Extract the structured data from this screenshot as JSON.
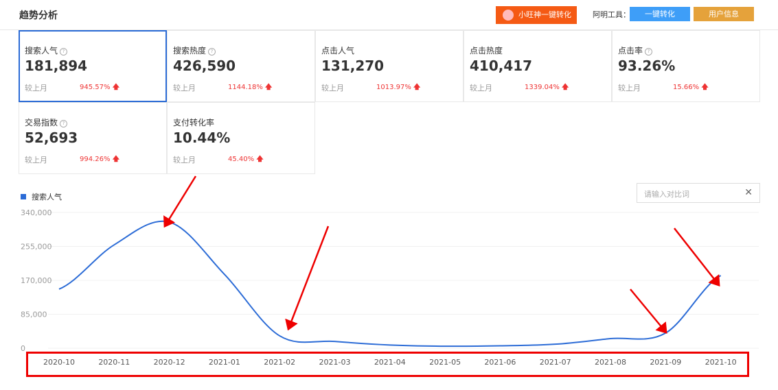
{
  "header": {
    "title": "趋势分析",
    "xiaowang_button": "小旺神一键转化",
    "tools_label": "阿明工具：",
    "convert_button": "一键转化",
    "user_info_button": "用户信息"
  },
  "cards": [
    {
      "label": "搜索人气",
      "value": "181,894",
      "compare": "较上月",
      "change": "945.57%",
      "help": true
    },
    {
      "label": "搜索热度",
      "value": "426,590",
      "compare": "较上月",
      "change": "1144.18%",
      "help": true
    },
    {
      "label": "点击人气",
      "value": "131,270",
      "compare": "较上月",
      "change": "1013.97%",
      "help": false
    },
    {
      "label": "点击热度",
      "value": "410,417",
      "compare": "较上月",
      "change": "1339.04%",
      "help": false
    },
    {
      "label": "点击率",
      "value": "93.26%",
      "compare": "较上月",
      "change": "15.66%",
      "help": true
    },
    {
      "label": "交易指数",
      "value": "52,693",
      "compare": "较上月",
      "change": "994.26%",
      "help": true
    },
    {
      "label": "支付转化率",
      "value": "10.44%",
      "compare": "较上月",
      "change": "45.40%",
      "help": false
    }
  ],
  "compare_input": {
    "placeholder": "请输入对比词"
  },
  "chart_data": {
    "type": "line",
    "series": [
      {
        "name": "搜索人气",
        "color": "#2b6bd6",
        "values": [
          148000,
          259000,
          316000,
          185000,
          31000,
          17000,
          8000,
          5000,
          6000,
          10000,
          24000,
          38000,
          181894
        ]
      }
    ],
    "categories": [
      "2020-10",
      "2020-11",
      "2020-12",
      "2021-01",
      "2021-02",
      "2021-03",
      "2021-04",
      "2021-05",
      "2021-06",
      "2021-07",
      "2021-08",
      "2021-09",
      "2021-10"
    ],
    "yticks": [
      "0",
      "85,000",
      "170,000",
      "255,000",
      "340,000"
    ],
    "ylim": [
      0,
      340000
    ],
    "legend": "top-left",
    "grid": true
  }
}
